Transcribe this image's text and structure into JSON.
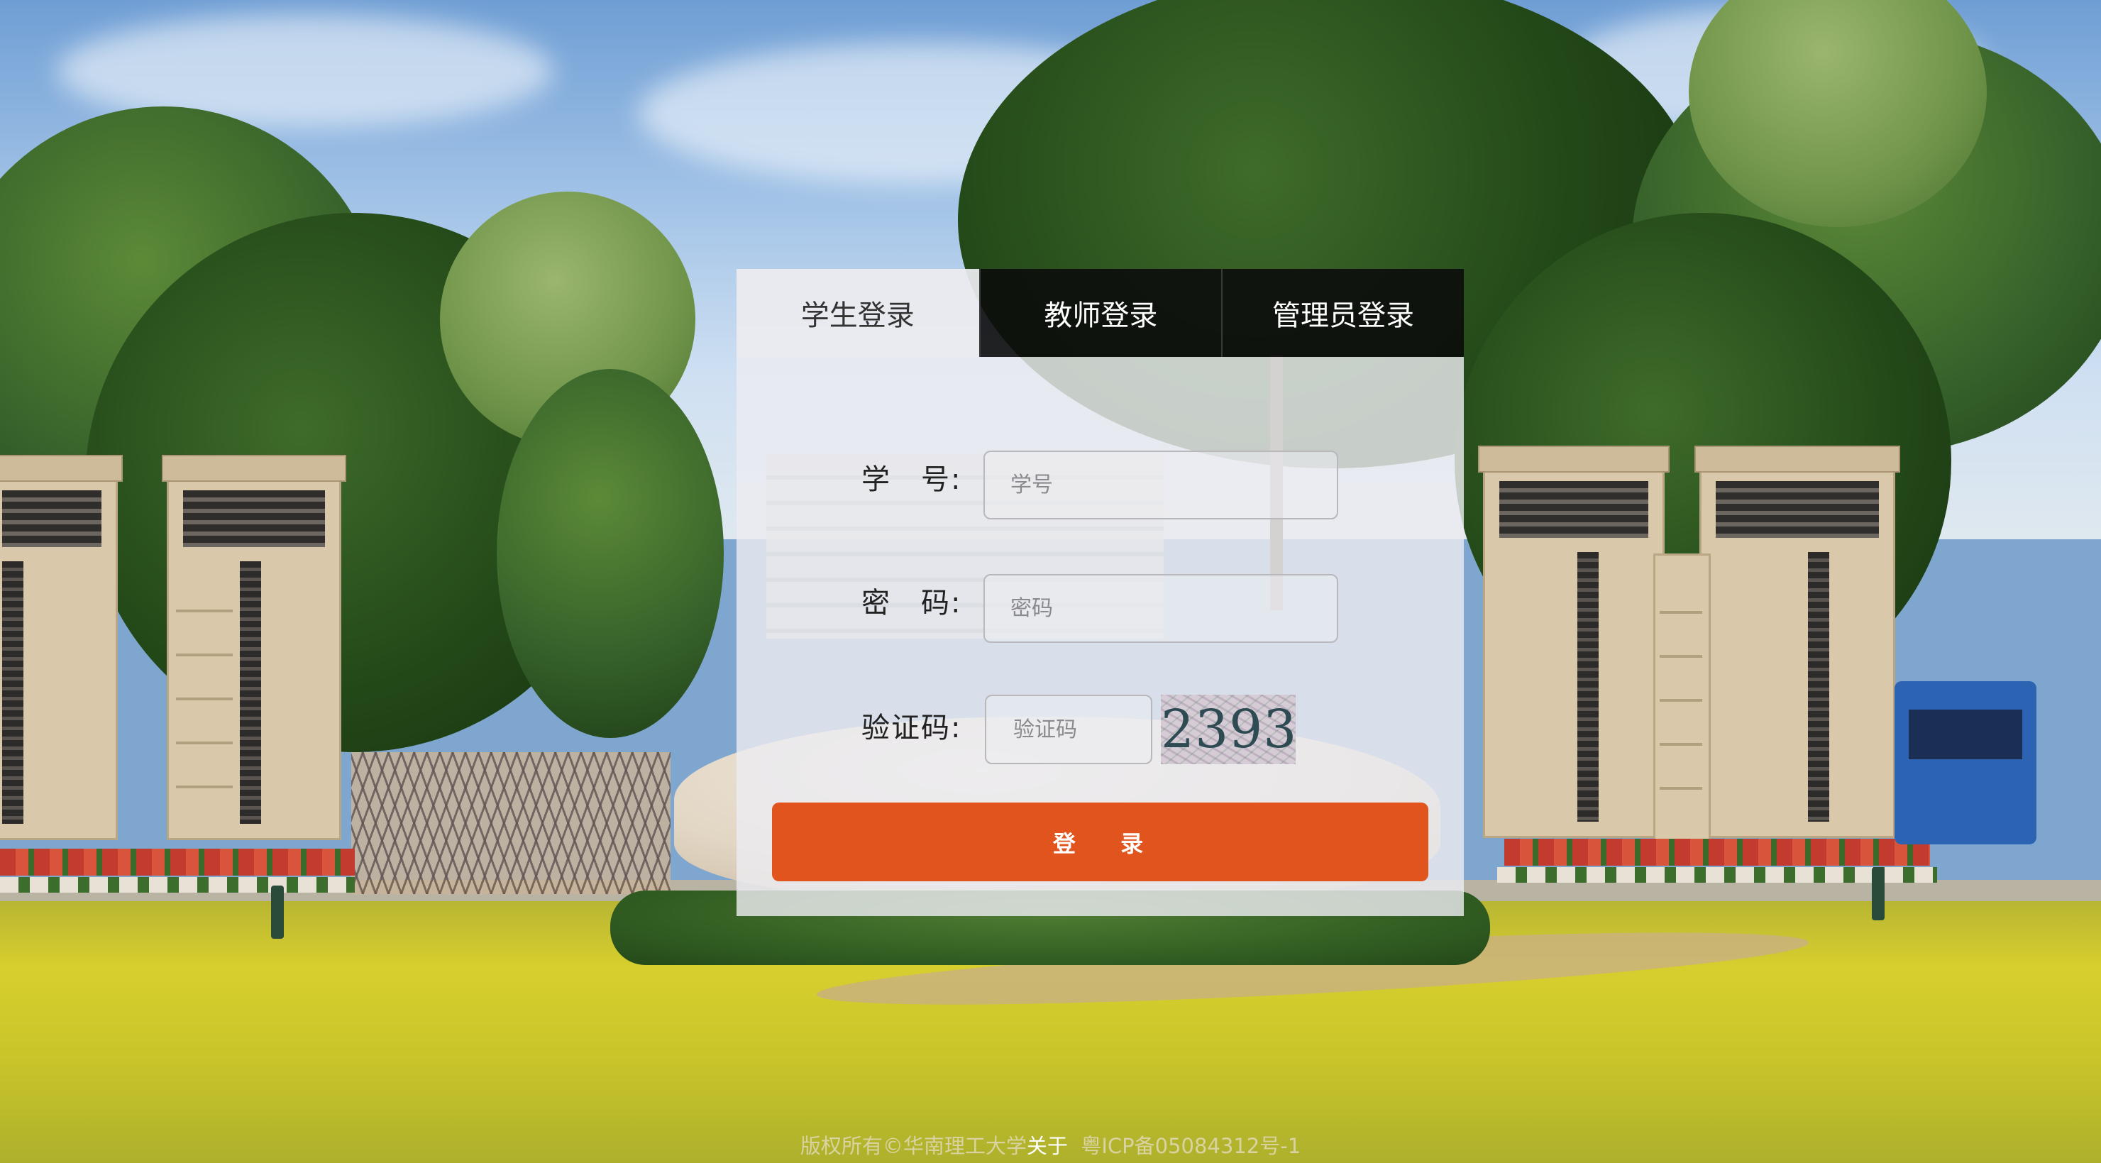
{
  "tabs": {
    "student": "学生登录",
    "teacher": "教师登录",
    "admin": "管理员登录"
  },
  "form": {
    "student_id_label": "学　号:",
    "student_id_placeholder": "学号",
    "password_label": "密　码:",
    "password_placeholder": "密码",
    "captcha_label": "验证码:",
    "captcha_placeholder": "验证码",
    "captcha_code": "2393",
    "login_button": "登 录"
  },
  "footer": {
    "copyright": "版权所有©华南理工大学",
    "about": "关于",
    "icp": "粤ICP备05084312号-1"
  },
  "colors": {
    "login_button": "#e2541e",
    "active_tab": "#ececf0",
    "inactive_tab": "#0c0c0c"
  }
}
